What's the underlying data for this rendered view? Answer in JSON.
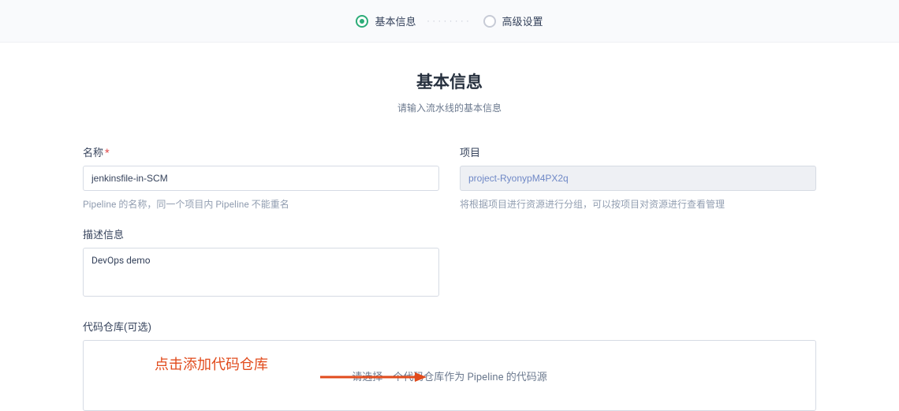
{
  "steps": {
    "active": "基本信息",
    "inactive": "高级设置"
  },
  "header": {
    "title": "基本信息",
    "subtitle": "请输入流水线的基本信息"
  },
  "form": {
    "name": {
      "label": "名称",
      "value": "jenkinsfile-in-SCM",
      "help": "Pipeline 的名称，同一个项目内 Pipeline 不能重名"
    },
    "project": {
      "label": "项目",
      "value": "project-RyonypM4PX2q",
      "help": "将根据项目进行资源进行分组，可以按项目对资源进行查看管理"
    },
    "description": {
      "label": "描述信息",
      "value": "DevOps demo"
    },
    "repo": {
      "label": "代码仓库(可选)",
      "placeholder": "请选择一个代码仓库作为 Pipeline 的代码源"
    }
  },
  "annotation": {
    "text": "点击添加代码仓库"
  },
  "colors": {
    "accent": "#2CAC78",
    "annotation": "#e14b1c"
  }
}
